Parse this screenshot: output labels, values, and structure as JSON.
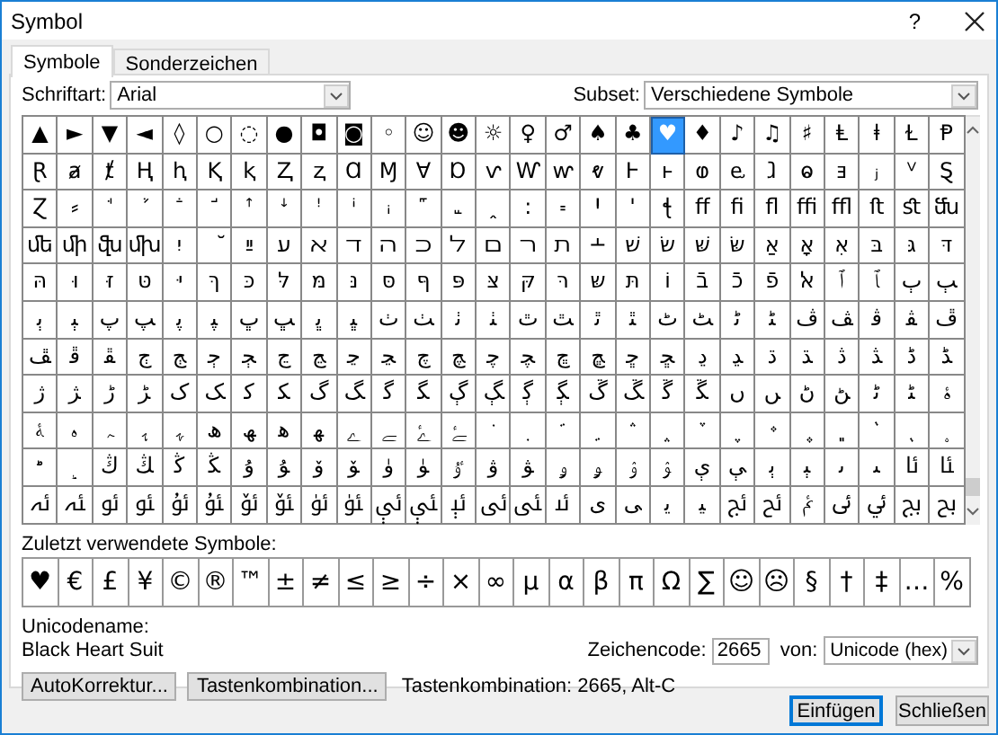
{
  "window": {
    "title": "Symbol",
    "help": "?"
  },
  "tabs": [
    {
      "label": "Symbole",
      "selected": true
    },
    {
      "label": "Sonderzeichen",
      "selected": false
    }
  ],
  "font": {
    "label": "Schriftart:",
    "value": "Arial"
  },
  "subset": {
    "label": "Subset:",
    "value": "Verschiedene Symbole"
  },
  "grid": {
    "rows": [
      [
        {
          "char": "▲",
          "selected": false
        },
        {
          "char": "►",
          "selected": false
        },
        {
          "char": "▼",
          "selected": false
        },
        {
          "char": "◄",
          "selected": false
        },
        {
          "char": "◊",
          "selected": false
        },
        {
          "char": "○",
          "selected": false
        },
        {
          "char": "◌",
          "selected": false
        },
        {
          "char": "●",
          "selected": false
        },
        {
          "char": "◘",
          "selected": false
        },
        {
          "char": "◙",
          "selected": false
        },
        {
          "char": "◦",
          "selected": false
        },
        {
          "char": "☺",
          "selected": false
        },
        {
          "char": "☻",
          "selected": false
        },
        {
          "char": "☼",
          "selected": false
        },
        {
          "char": "♀",
          "selected": false
        },
        {
          "char": "♂",
          "selected": false
        },
        {
          "char": "♠",
          "selected": false
        },
        {
          "char": "♣",
          "selected": false
        },
        {
          "char": "♥",
          "selected": true
        },
        {
          "char": "♦",
          "selected": false
        },
        {
          "char": "♪",
          "selected": false
        },
        {
          "char": "♫",
          "selected": false
        },
        {
          "char": "♯",
          "selected": false
        },
        {
          "char": "Ⱡ",
          "selected": false
        },
        {
          "char": "ⱡ",
          "selected": false
        },
        {
          "char": "Ɫ",
          "selected": false
        },
        {
          "char": "Ᵽ",
          "selected": false
        }
      ],
      [
        {
          "char": "Ɽ",
          "selected": false
        },
        {
          "char": "ⱥ",
          "selected": false
        },
        {
          "char": "ⱦ",
          "selected": false
        },
        {
          "char": "Ⱨ",
          "selected": false
        },
        {
          "char": "ⱨ",
          "selected": false
        },
        {
          "char": "Ⱪ",
          "selected": false
        },
        {
          "char": "ⱪ",
          "selected": false
        },
        {
          "char": "Ⱬ",
          "selected": false
        },
        {
          "char": "ⱬ",
          "selected": false
        },
        {
          "char": "Ɑ",
          "selected": false
        },
        {
          "char": "Ɱ",
          "selected": false
        },
        {
          "char": "Ɐ",
          "selected": false
        },
        {
          "char": "Ɒ",
          "selected": false
        },
        {
          "char": "ⱱ",
          "selected": false
        },
        {
          "char": "Ⱳ",
          "selected": false
        },
        {
          "char": "ⱳ",
          "selected": false
        },
        {
          "char": "ⱴ",
          "selected": false
        },
        {
          "char": "Ⱶ",
          "selected": false
        },
        {
          "char": "ⱶ",
          "selected": false
        },
        {
          "char": "ⱷ",
          "selected": false
        },
        {
          "char": "ⱸ",
          "selected": false
        },
        {
          "char": "ⱹ",
          "selected": false
        },
        {
          "char": "ⱺ",
          "selected": false
        },
        {
          "char": "ⱻ",
          "selected": false
        },
        {
          "char": "ⱼ",
          "selected": false
        },
        {
          "char": "ⱽ",
          "selected": false
        },
        {
          "char": "Ȿ",
          "selected": false
        }
      ],
      [
        {
          "char": "Ɀ",
          "selected": false
        },
        {
          "char": "⸗",
          "selected": false
        },
        {
          "char": "ꜗ",
          "selected": false
        },
        {
          "char": "ꜘ",
          "selected": false
        },
        {
          "char": "ꜙ",
          "selected": false
        },
        {
          "char": "ꜚ",
          "selected": false
        },
        {
          "char": "ꜛ",
          "selected": false
        },
        {
          "char": "ꜜ",
          "selected": false
        },
        {
          "char": "ꜝ",
          "selected": false
        },
        {
          "char": "ꜞ",
          "selected": false
        },
        {
          "char": "ꜟ",
          "selected": false
        },
        {
          "char": "꜠",
          "selected": false
        },
        {
          "char": "꜡",
          "selected": false
        },
        {
          "char": "ꞈ",
          "selected": false
        },
        {
          "char": "꞉",
          "selected": false
        },
        {
          "char": "꞊",
          "selected": false
        },
        {
          "char": "Ꞌ",
          "selected": false
        },
        {
          "char": "ꞌ",
          "selected": false
        },
        {
          "char": "ꞎ",
          "selected": false
        },
        {
          "char": "ﬀ",
          "selected": false
        },
        {
          "char": "ﬁ",
          "selected": false
        },
        {
          "char": "ﬂ",
          "selected": false
        },
        {
          "char": "ﬃ",
          "selected": false
        },
        {
          "char": "ﬄ",
          "selected": false
        },
        {
          "char": "ﬅ",
          "selected": false
        },
        {
          "char": "ﬆ",
          "selected": false
        },
        {
          "char": "ﬓ",
          "selected": false
        }
      ],
      [
        {
          "char": "ﬔ",
          "selected": false
        },
        {
          "char": "ﬕ",
          "selected": false
        },
        {
          "char": "ﬖ",
          "selected": false
        },
        {
          "char": "ﬗ",
          "selected": false
        },
        {
          "char": "יִ",
          "selected": false
        },
        {
          "char": "ﬞ",
          "selected": false
        },
        {
          "char": "ײַ",
          "selected": false
        },
        {
          "char": "ﬠ",
          "selected": false
        },
        {
          "char": "ﬡ",
          "selected": false
        },
        {
          "char": "ﬢ",
          "selected": false
        },
        {
          "char": "ﬣ",
          "selected": false
        },
        {
          "char": "ﬤ",
          "selected": false
        },
        {
          "char": "ﬥ",
          "selected": false
        },
        {
          "char": "ﬦ",
          "selected": false
        },
        {
          "char": "ﬧ",
          "selected": false
        },
        {
          "char": "ﬨ",
          "selected": false
        },
        {
          "char": "﬩",
          "selected": false
        },
        {
          "char": "שׁ",
          "selected": false
        },
        {
          "char": "שׂ",
          "selected": false
        },
        {
          "char": "שּׁ",
          "selected": false
        },
        {
          "char": "שּׂ",
          "selected": false
        },
        {
          "char": "אַ",
          "selected": false
        },
        {
          "char": "אָ",
          "selected": false
        },
        {
          "char": "אּ",
          "selected": false
        },
        {
          "char": "בּ",
          "selected": false
        },
        {
          "char": "גּ",
          "selected": false
        },
        {
          "char": "דּ",
          "selected": false
        }
      ],
      [
        {
          "char": "הּ",
          "selected": false
        },
        {
          "char": "וּ",
          "selected": false
        },
        {
          "char": "זּ",
          "selected": false
        },
        {
          "char": "טּ",
          "selected": false
        },
        {
          "char": "יּ",
          "selected": false
        },
        {
          "char": "ךּ",
          "selected": false
        },
        {
          "char": "כּ",
          "selected": false
        },
        {
          "char": "לּ",
          "selected": false
        },
        {
          "char": "מּ",
          "selected": false
        },
        {
          "char": "נּ",
          "selected": false
        },
        {
          "char": "סּ",
          "selected": false
        },
        {
          "char": "ףּ",
          "selected": false
        },
        {
          "char": "פּ",
          "selected": false
        },
        {
          "char": "צּ",
          "selected": false
        },
        {
          "char": "קּ",
          "selected": false
        },
        {
          "char": "רּ",
          "selected": false
        },
        {
          "char": "שּ",
          "selected": false
        },
        {
          "char": "תּ",
          "selected": false
        },
        {
          "char": "וֹ",
          "selected": false
        },
        {
          "char": "בֿ",
          "selected": false
        },
        {
          "char": "כֿ",
          "selected": false
        },
        {
          "char": "פֿ",
          "selected": false
        },
        {
          "char": "ﭏ",
          "selected": false
        },
        {
          "char": "ﭐ",
          "selected": false
        },
        {
          "char": "ﭑ",
          "selected": false
        },
        {
          "char": "ﭒ",
          "selected": false
        },
        {
          "char": "ﭓ",
          "selected": false
        }
      ],
      [
        {
          "char": "ﭔ",
          "selected": false
        },
        {
          "char": "ﭕ",
          "selected": false
        },
        {
          "char": "ﭖ",
          "selected": false
        },
        {
          "char": "ﭗ",
          "selected": false
        },
        {
          "char": "ﭘ",
          "selected": false
        },
        {
          "char": "ﭙ",
          "selected": false
        },
        {
          "char": "ﭚ",
          "selected": false
        },
        {
          "char": "ﭛ",
          "selected": false
        },
        {
          "char": "ﭜ",
          "selected": false
        },
        {
          "char": "ﭝ",
          "selected": false
        },
        {
          "char": "ﭞ",
          "selected": false
        },
        {
          "char": "ﭟ",
          "selected": false
        },
        {
          "char": "ﭠ",
          "selected": false
        },
        {
          "char": "ﭡ",
          "selected": false
        },
        {
          "char": "ﭢ",
          "selected": false
        },
        {
          "char": "ﭣ",
          "selected": false
        },
        {
          "char": "ﭤ",
          "selected": false
        },
        {
          "char": "ﭥ",
          "selected": false
        },
        {
          "char": "ﭦ",
          "selected": false
        },
        {
          "char": "ﭧ",
          "selected": false
        },
        {
          "char": "ﭨ",
          "selected": false
        },
        {
          "char": "ﭩ",
          "selected": false
        },
        {
          "char": "ﭪ",
          "selected": false
        },
        {
          "char": "ﭫ",
          "selected": false
        },
        {
          "char": "ﭬ",
          "selected": false
        },
        {
          "char": "ﭭ",
          "selected": false
        },
        {
          "char": "ﭮ",
          "selected": false
        }
      ],
      [
        {
          "char": "ﭯ",
          "selected": false
        },
        {
          "char": "ﭰ",
          "selected": false
        },
        {
          "char": "ﭱ",
          "selected": false
        },
        {
          "char": "ﭲ",
          "selected": false
        },
        {
          "char": "ﭳ",
          "selected": false
        },
        {
          "char": "ﭴ",
          "selected": false
        },
        {
          "char": "ﭵ",
          "selected": false
        },
        {
          "char": "ﭶ",
          "selected": false
        },
        {
          "char": "ﭷ",
          "selected": false
        },
        {
          "char": "ﭸ",
          "selected": false
        },
        {
          "char": "ﭹ",
          "selected": false
        },
        {
          "char": "ﭺ",
          "selected": false
        },
        {
          "char": "ﭻ",
          "selected": false
        },
        {
          "char": "ﭼ",
          "selected": false
        },
        {
          "char": "ﭽ",
          "selected": false
        },
        {
          "char": "ﭾ",
          "selected": false
        },
        {
          "char": "ﭿ",
          "selected": false
        },
        {
          "char": "ﮀ",
          "selected": false
        },
        {
          "char": "ﮁ",
          "selected": false
        },
        {
          "char": "ﮂ",
          "selected": false
        },
        {
          "char": "ﮃ",
          "selected": false
        },
        {
          "char": "ﮄ",
          "selected": false
        },
        {
          "char": "ﮅ",
          "selected": false
        },
        {
          "char": "ﮆ",
          "selected": false
        },
        {
          "char": "ﮇ",
          "selected": false
        },
        {
          "char": "ﮈ",
          "selected": false
        },
        {
          "char": "ﮉ",
          "selected": false
        }
      ],
      [
        {
          "char": "ﮊ",
          "selected": false
        },
        {
          "char": "ﮋ",
          "selected": false
        },
        {
          "char": "ﮌ",
          "selected": false
        },
        {
          "char": "ﮍ",
          "selected": false
        },
        {
          "char": "ﮎ",
          "selected": false
        },
        {
          "char": "ﮏ",
          "selected": false
        },
        {
          "char": "ﮐ",
          "selected": false
        },
        {
          "char": "ﮑ",
          "selected": false
        },
        {
          "char": "ﮒ",
          "selected": false
        },
        {
          "char": "ﮓ",
          "selected": false
        },
        {
          "char": "ﮔ",
          "selected": false
        },
        {
          "char": "ﮕ",
          "selected": false
        },
        {
          "char": "ﮖ",
          "selected": false
        },
        {
          "char": "ﮗ",
          "selected": false
        },
        {
          "char": "ﮘ",
          "selected": false
        },
        {
          "char": "ﮙ",
          "selected": false
        },
        {
          "char": "ﮚ",
          "selected": false
        },
        {
          "char": "ﮛ",
          "selected": false
        },
        {
          "char": "ﮜ",
          "selected": false
        },
        {
          "char": "ﮝ",
          "selected": false
        },
        {
          "char": "ﮞ",
          "selected": false
        },
        {
          "char": "ﮟ",
          "selected": false
        },
        {
          "char": "ﮠ",
          "selected": false
        },
        {
          "char": "ﮡ",
          "selected": false
        },
        {
          "char": "ﮢ",
          "selected": false
        },
        {
          "char": "ﮣ",
          "selected": false
        },
        {
          "char": "ﮤ",
          "selected": false
        }
      ],
      [
        {
          "char": "ﮥ",
          "selected": false
        },
        {
          "char": "ﮦ",
          "selected": false
        },
        {
          "char": "ﮧ",
          "selected": false
        },
        {
          "char": "ﮨ",
          "selected": false
        },
        {
          "char": "ﮩ",
          "selected": false
        },
        {
          "char": "ﮪ",
          "selected": false
        },
        {
          "char": "ﮫ",
          "selected": false
        },
        {
          "char": "ﮬ",
          "selected": false
        },
        {
          "char": "ﮭ",
          "selected": false
        },
        {
          "char": "ﮮ",
          "selected": false
        },
        {
          "char": "ﮯ",
          "selected": false
        },
        {
          "char": "ﮰ",
          "selected": false
        },
        {
          "char": "ﮱ",
          "selected": false
        },
        {
          "char": "﮲",
          "selected": false
        },
        {
          "char": "﮳",
          "selected": false
        },
        {
          "char": "﮴",
          "selected": false
        },
        {
          "char": "﮵",
          "selected": false
        },
        {
          "char": "﮶",
          "selected": false
        },
        {
          "char": "﮷",
          "selected": false
        },
        {
          "char": "﮸",
          "selected": false
        },
        {
          "char": "﮹",
          "selected": false
        },
        {
          "char": "﮺",
          "selected": false
        },
        {
          "char": "﮻",
          "selected": false
        },
        {
          "char": "﮼",
          "selected": false
        },
        {
          "char": "﮽",
          "selected": false
        },
        {
          "char": "﮾",
          "selected": false
        },
        {
          "char": "﮿",
          "selected": false
        }
      ],
      [
        {
          "char": "﯀",
          "selected": false
        },
        {
          "char": "﯁",
          "selected": false
        },
        {
          "char": "ﯓ",
          "selected": false
        },
        {
          "char": "ﯔ",
          "selected": false
        },
        {
          "char": "ﯕ",
          "selected": false
        },
        {
          "char": "ﯖ",
          "selected": false
        },
        {
          "char": "ﯗ",
          "selected": false
        },
        {
          "char": "ﯘ",
          "selected": false
        },
        {
          "char": "ﯙ",
          "selected": false
        },
        {
          "char": "ﯚ",
          "selected": false
        },
        {
          "char": "ﯛ",
          "selected": false
        },
        {
          "char": "ﯜ",
          "selected": false
        },
        {
          "char": "ﯝ",
          "selected": false
        },
        {
          "char": "ﯞ",
          "selected": false
        },
        {
          "char": "ﯟ",
          "selected": false
        },
        {
          "char": "ﯠ",
          "selected": false
        },
        {
          "char": "ﯡ",
          "selected": false
        },
        {
          "char": "ﯢ",
          "selected": false
        },
        {
          "char": "ﯣ",
          "selected": false
        },
        {
          "char": "ﯤ",
          "selected": false
        },
        {
          "char": "ﯥ",
          "selected": false
        },
        {
          "char": "ﯦ",
          "selected": false
        },
        {
          "char": "ﯧ",
          "selected": false
        },
        {
          "char": "ﯨ",
          "selected": false
        },
        {
          "char": "ﯩ",
          "selected": false
        },
        {
          "char": "ﯪ",
          "selected": false
        },
        {
          "char": "ﯫ",
          "selected": false
        }
      ],
      [
        {
          "char": "ﯬ",
          "selected": false
        },
        {
          "char": "ﯭ",
          "selected": false
        },
        {
          "char": "ﯮ",
          "selected": false
        },
        {
          "char": "ﯯ",
          "selected": false
        },
        {
          "char": "ﯰ",
          "selected": false
        },
        {
          "char": "ﯱ",
          "selected": false
        },
        {
          "char": "ﯲ",
          "selected": false
        },
        {
          "char": "ﯳ",
          "selected": false
        },
        {
          "char": "ﯴ",
          "selected": false
        },
        {
          "char": "ﯵ",
          "selected": false
        },
        {
          "char": "ﯶ",
          "selected": false
        },
        {
          "char": "ﯷ",
          "selected": false
        },
        {
          "char": "ﯸ",
          "selected": false
        },
        {
          "char": "ﯹ",
          "selected": false
        },
        {
          "char": "ﯺ",
          "selected": false
        },
        {
          "char": "ﯻ",
          "selected": false
        },
        {
          "char": "ﯼ",
          "selected": false
        },
        {
          "char": "ﯽ",
          "selected": false
        },
        {
          "char": "ﯾ",
          "selected": false
        },
        {
          "char": "ﯿ",
          "selected": false
        },
        {
          "char": "ﰀ",
          "selected": false
        },
        {
          "char": "ﰁ",
          "selected": false
        },
        {
          "char": "ﰂ",
          "selected": false
        },
        {
          "char": "ﰃ",
          "selected": false
        },
        {
          "char": "ﰄ",
          "selected": false
        },
        {
          "char": "ﰅ",
          "selected": false
        },
        {
          "char": "ﰆ",
          "selected": false
        }
      ]
    ]
  },
  "recent": {
    "label": "Zuletzt verwendete Symbole:",
    "symbols": [
      {
        "char": "♥",
        "selected": false
      },
      {
        "char": "€",
        "selected": false
      },
      {
        "char": "£",
        "selected": false
      },
      {
        "char": "¥",
        "selected": false
      },
      {
        "char": "©",
        "selected": false
      },
      {
        "char": "®",
        "selected": false
      },
      {
        "char": "™",
        "selected": false
      },
      {
        "char": "±",
        "selected": false
      },
      {
        "char": "≠",
        "selected": false
      },
      {
        "char": "≤",
        "selected": false
      },
      {
        "char": "≥",
        "selected": false
      },
      {
        "char": "÷",
        "selected": false
      },
      {
        "char": "×",
        "selected": false
      },
      {
        "char": "∞",
        "selected": false
      },
      {
        "char": "µ",
        "selected": false
      },
      {
        "char": "α",
        "selected": false
      },
      {
        "char": "β",
        "selected": false
      },
      {
        "char": "π",
        "selected": false
      },
      {
        "char": "Ω",
        "selected": false
      },
      {
        "char": "∑",
        "selected": false
      },
      {
        "char": "☺",
        "selected": false
      },
      {
        "char": "☹",
        "selected": false
      },
      {
        "char": "§",
        "selected": false
      },
      {
        "char": "†",
        "selected": false
      },
      {
        "char": "‡",
        "selected": false
      },
      {
        "char": "…",
        "selected": false
      },
      {
        "char": "%",
        "selected": false
      }
    ]
  },
  "unicode_name": {
    "label": "Unicodename:",
    "value": "Black Heart Suit"
  },
  "char_code": {
    "label": "Zeichencode:",
    "value": "2665"
  },
  "from": {
    "label": "von:",
    "value": "Unicode (hex)"
  },
  "buttons": [
    {
      "label": "AutoKorrektur..."
    },
    {
      "label": "Tastenkombination..."
    }
  ],
  "shortcut_text": "Tastenkombination: 2665, Alt-C",
  "footer_buttons": [
    {
      "label": "Einfügen",
      "default": true
    },
    {
      "label": "Schließen",
      "default": false
    }
  ]
}
